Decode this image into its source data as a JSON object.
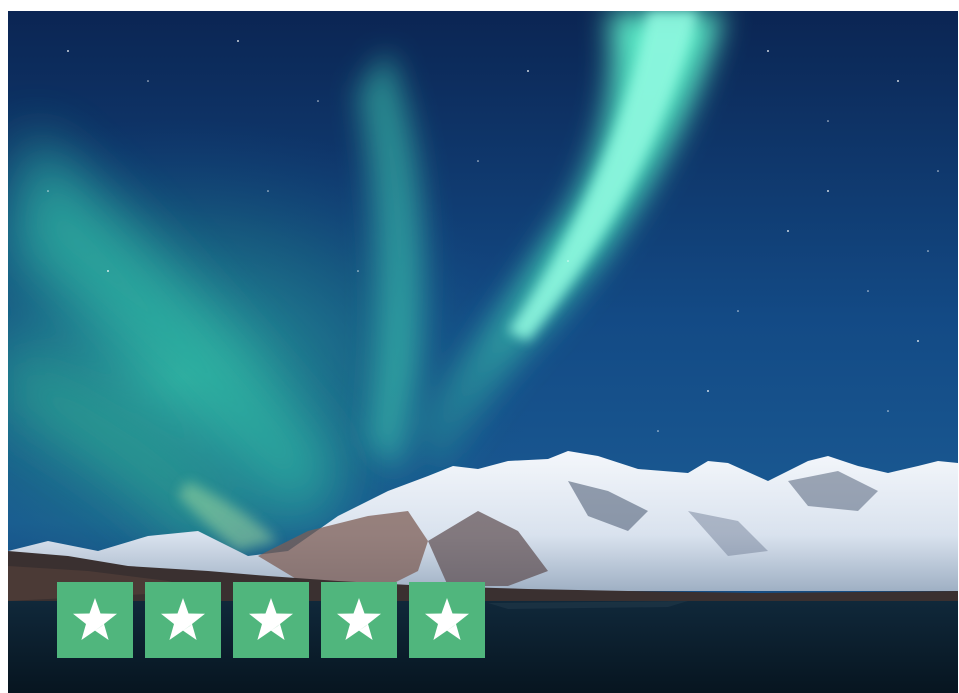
{
  "image": {
    "subject": "aurora-over-snowy-mountains-at-night"
  },
  "rating": {
    "stars_filled": 5,
    "stars_total": 5,
    "tile_color": "#50b67d",
    "star_color": "#ffffff"
  },
  "colors": {
    "sky_top": "#0c2a5a",
    "sky_mid": "#154a86",
    "aurora_core": "#5ef0c4",
    "aurora_glow": "#2aa89a",
    "snow": "#eef3f8",
    "water": "#0a1e2c"
  }
}
